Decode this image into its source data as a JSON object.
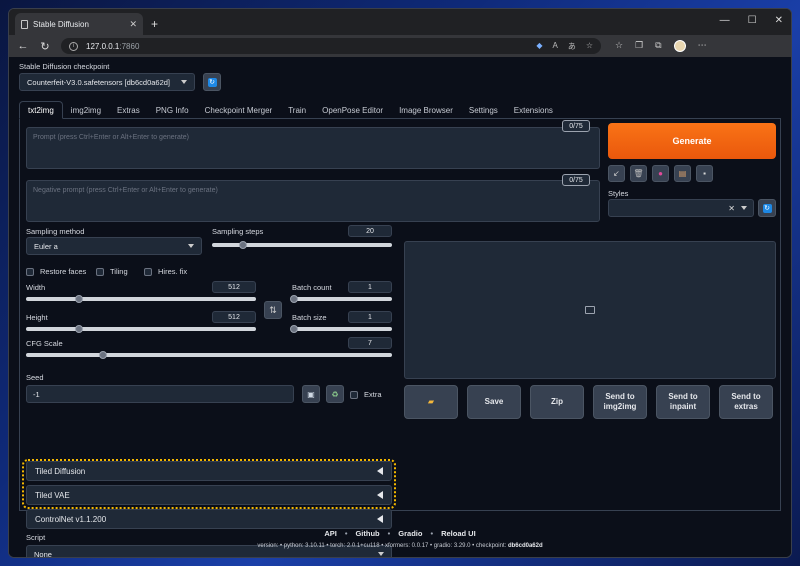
{
  "browser": {
    "tab_title": "Stable Diffusion",
    "url_host": "127.0.0.1",
    "url_port": ":7860"
  },
  "checkpoint": {
    "label": "Stable Diffusion checkpoint",
    "value": "Counterfeit-V3.0.safetensors [db6cd0a62d]"
  },
  "tabs": [
    "txt2img",
    "img2img",
    "Extras",
    "PNG Info",
    "Checkpoint Merger",
    "Train",
    "OpenPose Editor",
    "Image Browser",
    "Settings",
    "Extensions"
  ],
  "prompt": {
    "placeholder": "Prompt (press Ctrl+Enter or Alt+Enter to generate)",
    "counter": "0/75",
    "neg_placeholder": "Negative prompt (press Ctrl+Enter or Alt+Enter to generate)",
    "neg_counter": "0/75"
  },
  "generate_label": "Generate",
  "styles_label": "Styles",
  "sampling": {
    "method_label": "Sampling method",
    "method_value": "Euler a",
    "steps_label": "Sampling steps",
    "steps_value": "20",
    "steps_level": 0.17
  },
  "checks": {
    "restore_faces": "Restore faces",
    "tiling": "Tiling",
    "hires_fix": "Hires. fix"
  },
  "size": {
    "width_label": "Width",
    "width_value": "512",
    "width_level": 0.23,
    "height_label": "Height",
    "height_value": "512",
    "height_level": 0.23
  },
  "batch": {
    "count_label": "Batch count",
    "count_value": "1",
    "size_label": "Batch size",
    "size_value": "1"
  },
  "cfg": {
    "label": "CFG Scale",
    "value": "7",
    "level": 0.21
  },
  "seed": {
    "label": "Seed",
    "value": "-1",
    "extra_label": "Extra"
  },
  "accordions": {
    "tiled_diffusion": "Tiled Diffusion",
    "tiled_vae": "Tiled VAE",
    "controlnet": "ControlNet v1.1.200"
  },
  "script": {
    "label": "Script",
    "value": "None"
  },
  "output_buttons": {
    "save": "Save",
    "zip": "Zip",
    "send_img2img": "Send to img2img",
    "send_inpaint": "Send to inpaint",
    "send_extras": "Send to extras"
  },
  "footer": {
    "links": [
      "API",
      "Github",
      "Gradio",
      "Reload UI"
    ],
    "version": "version: •  python: 3.10.11  •  torch: 2.0.1+cu118  •  xformers: 0.0.17  •  gradio: 3.29.0  •  checkpoint: ",
    "checkpoint_hash": "db6cd0a62d"
  },
  "colors": {
    "accent_orange": "#f97316",
    "refresh_blue": "#1e88e5",
    "highlight_yellow": "#f5b800"
  }
}
